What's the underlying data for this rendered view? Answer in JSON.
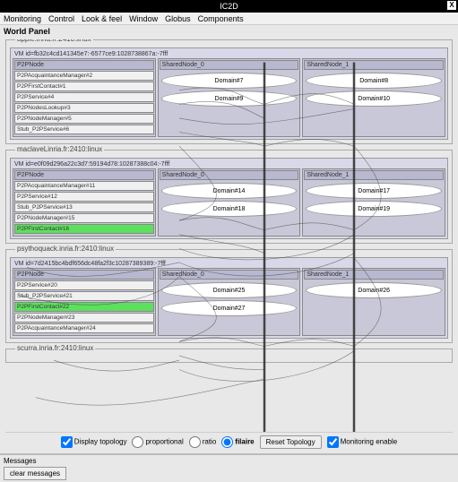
{
  "window": {
    "title": "IC2D",
    "close": "X"
  },
  "menu": {
    "items": [
      "Monitoring",
      "Control",
      "Look & feel",
      "Window",
      "Globus",
      "Components"
    ]
  },
  "world_panel": {
    "label": "World Panel"
  },
  "hosts": [
    {
      "title": "apple.inria.fr:2410:linux",
      "vm_id": "VM id=fb32c4cd141345e7:-6577ce9:1028738867a:-7fff",
      "nodes": [
        {
          "header": "P2PNode",
          "aos": [
            {
              "label": "P2PAcquaintanceManager#2"
            },
            {
              "label": "P2PFirstContact#1"
            },
            {
              "label": "P2PService#4"
            },
            {
              "label": "P2PNodesLookup#3"
            },
            {
              "label": "P2PNodeManager#5"
            },
            {
              "label": "Stub_P2PService#6"
            }
          ]
        },
        {
          "header": "SharedNode_0",
          "domains": [
            "Domain#7",
            "Domain#9"
          ]
        },
        {
          "header": "SharedNode_1",
          "domains": [
            "Domain#8",
            "Domain#10"
          ]
        }
      ]
    },
    {
      "title": "maclaveLinria.fr:2410:linux",
      "vm_id": "VM id=e0f09d296a22c3d7:59194d78:10287388c04:-7fff",
      "nodes": [
        {
          "header": "P2PNode",
          "aos": [
            {
              "label": "P2PAcquaintanceManager#11"
            },
            {
              "label": "P2PService#12"
            },
            {
              "label": "Stub_P2PService#13"
            },
            {
              "label": "P2PNodeManager#15"
            },
            {
              "label": "P2PFirstContact#16",
              "green": true
            }
          ]
        },
        {
          "header": "SharedNode_0",
          "domains": [
            "Domain#14",
            "Domain#18"
          ]
        },
        {
          "header": "SharedNode_1",
          "domains": [
            "Domain#17",
            "Domain#19"
          ]
        }
      ]
    },
    {
      "title": "psythoquack.inria.fr:2410:linux",
      "vm_id": "VM id=7d2415bc4bdf656dc48fa2f3c10287389389:-7fff",
      "nodes": [
        {
          "header": "P2PNode",
          "aos": [
            {
              "label": "P2PService#20"
            },
            {
              "label": "Stub_P2PService#21"
            },
            {
              "label": "P2PFirstContact#22",
              "green": true
            },
            {
              "label": "P2PNodeManager#23"
            },
            {
              "label": "P2PAcquaintanceManager#24"
            }
          ]
        },
        {
          "header": "SharedNode_0",
          "domains": [
            "Domain#25",
            "Domain#27"
          ]
        },
        {
          "header": "SharedNode_1",
          "domains": [
            "Domain#26"
          ]
        }
      ]
    },
    {
      "title": "scurra.inria.fr:2410:linux",
      "collapsed": true
    }
  ],
  "controls": {
    "display_topology": "Display topology",
    "proportional": "proportional",
    "ratio": "ratio",
    "filaire": "filaire",
    "reset": "Reset Topology",
    "monitoring": "Monitoring enable",
    "display_topology_checked": true,
    "filaire_selected": true,
    "monitoring_checked": true
  },
  "messages": {
    "label": "Messages",
    "clear": "clear messages"
  }
}
